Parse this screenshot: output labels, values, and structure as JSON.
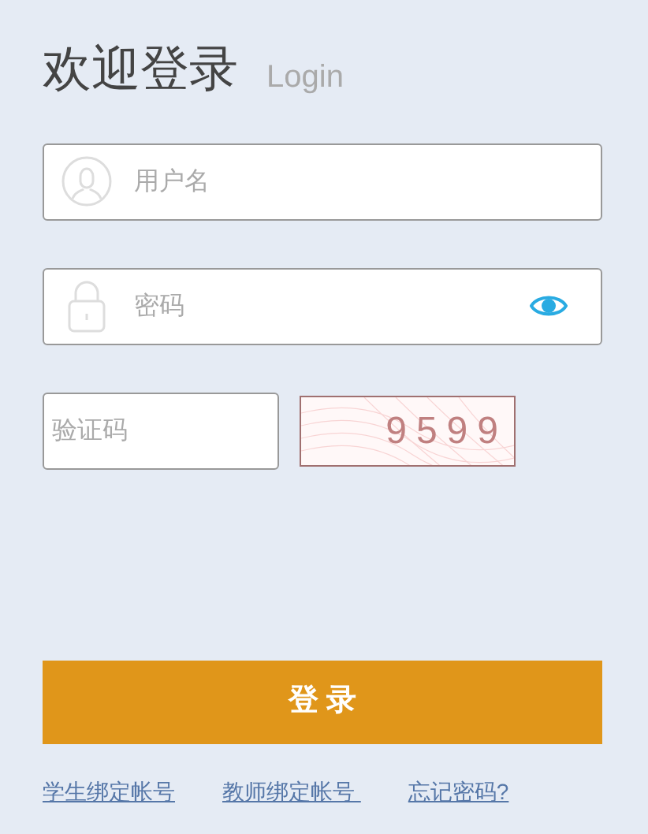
{
  "heading": {
    "title": "欢迎登录",
    "subtitle": "Login"
  },
  "username": {
    "placeholder": "用户名"
  },
  "password": {
    "placeholder": "密码"
  },
  "captcha": {
    "placeholder": "验证码",
    "code": "9599"
  },
  "login_button": "登 录",
  "links": [
    "学生绑定帐号",
    "教师绑定帐号 ",
    "忘记密码?"
  ]
}
